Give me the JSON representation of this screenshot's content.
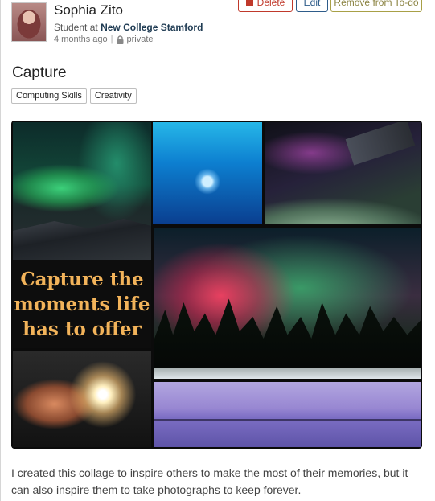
{
  "post": {
    "author_name": "Sophia Zito",
    "role_prefix": "Student at",
    "school": "New College Stamford",
    "time_ago": "4 months ago",
    "separator": "|",
    "visibility": "private",
    "title": "Capture",
    "tags": [
      "Computing Skills",
      "Creativity"
    ],
    "collage_quote": "Capture the\nmoments life\nhas to offer",
    "description": "I created this collage to inspire others to make the most of their memories, but it can also inspire them to take photographs to keep forever."
  },
  "actions": {
    "delete_label": "Delete",
    "edit_label": "Edit",
    "todo_label": "Remove from To-do"
  },
  "icons": {
    "delete": "trash-icon",
    "visibility": "lock-icon"
  },
  "colors": {
    "delete": "#c0392b",
    "edit": "#2e5c8a",
    "todo": "#a8a046",
    "quote": "#f2b35a",
    "school": "#1f3b53"
  }
}
